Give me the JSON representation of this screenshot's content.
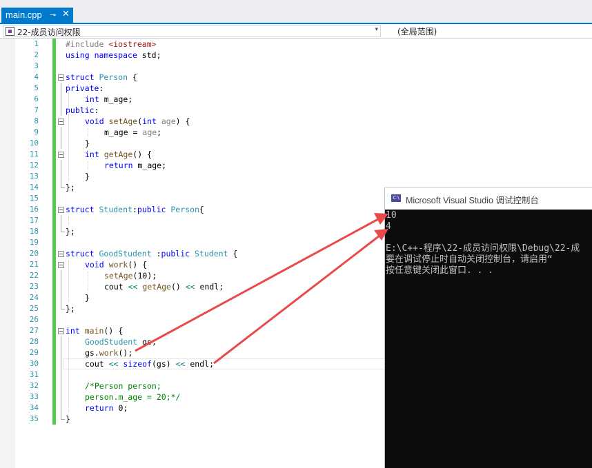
{
  "tab": {
    "filename": "main.cpp",
    "pin_glyph": "⊸",
    "close_glyph": "✕"
  },
  "navbar": {
    "scope_left": "22-成员访问权限",
    "scope_right": "(全局范围)"
  },
  "code_lines": [
    {
      "n": "1"
    },
    {
      "n": "2"
    },
    {
      "n": "3"
    },
    {
      "n": "4"
    },
    {
      "n": "5"
    },
    {
      "n": "6"
    },
    {
      "n": "7"
    },
    {
      "n": "8"
    },
    {
      "n": "9"
    },
    {
      "n": "10"
    },
    {
      "n": "11"
    },
    {
      "n": "12"
    },
    {
      "n": "13"
    },
    {
      "n": "14"
    },
    {
      "n": "15"
    },
    {
      "n": "16"
    },
    {
      "n": "17"
    },
    {
      "n": "18"
    },
    {
      "n": "19"
    },
    {
      "n": "20"
    },
    {
      "n": "21"
    },
    {
      "n": "22"
    },
    {
      "n": "23"
    },
    {
      "n": "24"
    },
    {
      "n": "25"
    },
    {
      "n": "26"
    },
    {
      "n": "27"
    },
    {
      "n": "28"
    },
    {
      "n": "29"
    },
    {
      "n": "30"
    },
    {
      "n": "31"
    },
    {
      "n": "32"
    },
    {
      "n": "33"
    },
    {
      "n": "34"
    },
    {
      "n": "35"
    }
  ],
  "code": {
    "l1": [
      "#include ",
      "<iostream>"
    ],
    "l2": [
      "using",
      " ",
      "namespace",
      " std;"
    ],
    "l4": [
      "struct",
      " ",
      "Person",
      " {"
    ],
    "l5": [
      "private",
      ":"
    ],
    "l6": [
      "int",
      " m_age;"
    ],
    "l7": [
      "public",
      ":"
    ],
    "l8": [
      "void",
      " ",
      "setAge",
      "(",
      "int",
      " ",
      "age",
      ") {"
    ],
    "l9": [
      "m_age = ",
      "age",
      ";"
    ],
    "l10": [
      "}"
    ],
    "l11": [
      "int",
      " ",
      "getAge",
      "() {"
    ],
    "l12": [
      "return",
      " m_age;"
    ],
    "l13": [
      "}"
    ],
    "l14": [
      "};"
    ],
    "l16": [
      "struct",
      " ",
      "Student",
      ":",
      "public",
      " ",
      "Person",
      "{"
    ],
    "l18": [
      "};"
    ],
    "l20": [
      "struct",
      " ",
      "GoodStudent",
      " :",
      "public",
      " ",
      "Student",
      " {"
    ],
    "l21": [
      "void",
      " ",
      "work",
      "() {"
    ],
    "l22": [
      "setAge",
      "(10);"
    ],
    "l23": [
      "cout ",
      "<<",
      " ",
      "getAge",
      "() ",
      "<<",
      " endl;"
    ],
    "l24": [
      "}"
    ],
    "l25": [
      "};"
    ],
    "l27": [
      "int",
      " ",
      "main",
      "() {"
    ],
    "l28": [
      "GoodStudent",
      " gs;"
    ],
    "l29": [
      "gs.",
      "work",
      "();"
    ],
    "l30": [
      "cout ",
      "<<",
      " ",
      "sizeof",
      "(gs) ",
      "<<",
      " endl;"
    ],
    "l32": [
      "/*Person person;"
    ],
    "l33": [
      "person.m_age = 20;*/"
    ],
    "l34": [
      "return",
      " 0;"
    ],
    "l35": [
      "}"
    ]
  },
  "console": {
    "title": "Microsoft Visual Studio 调试控制台",
    "icon_label": "C:\\",
    "output": [
      "10",
      "4",
      "",
      "E:\\C++-程序\\22-成员访问权限\\Debug\\22-成",
      "要在调试停止时自动关闭控制台，请启用“",
      "按任意键关闭此窗口. . ."
    ]
  },
  "colors": {
    "accent": "#007acc",
    "arrow": "#e84a4a",
    "change_bar": "#57c953",
    "console_bg": "#0c0c0c"
  }
}
